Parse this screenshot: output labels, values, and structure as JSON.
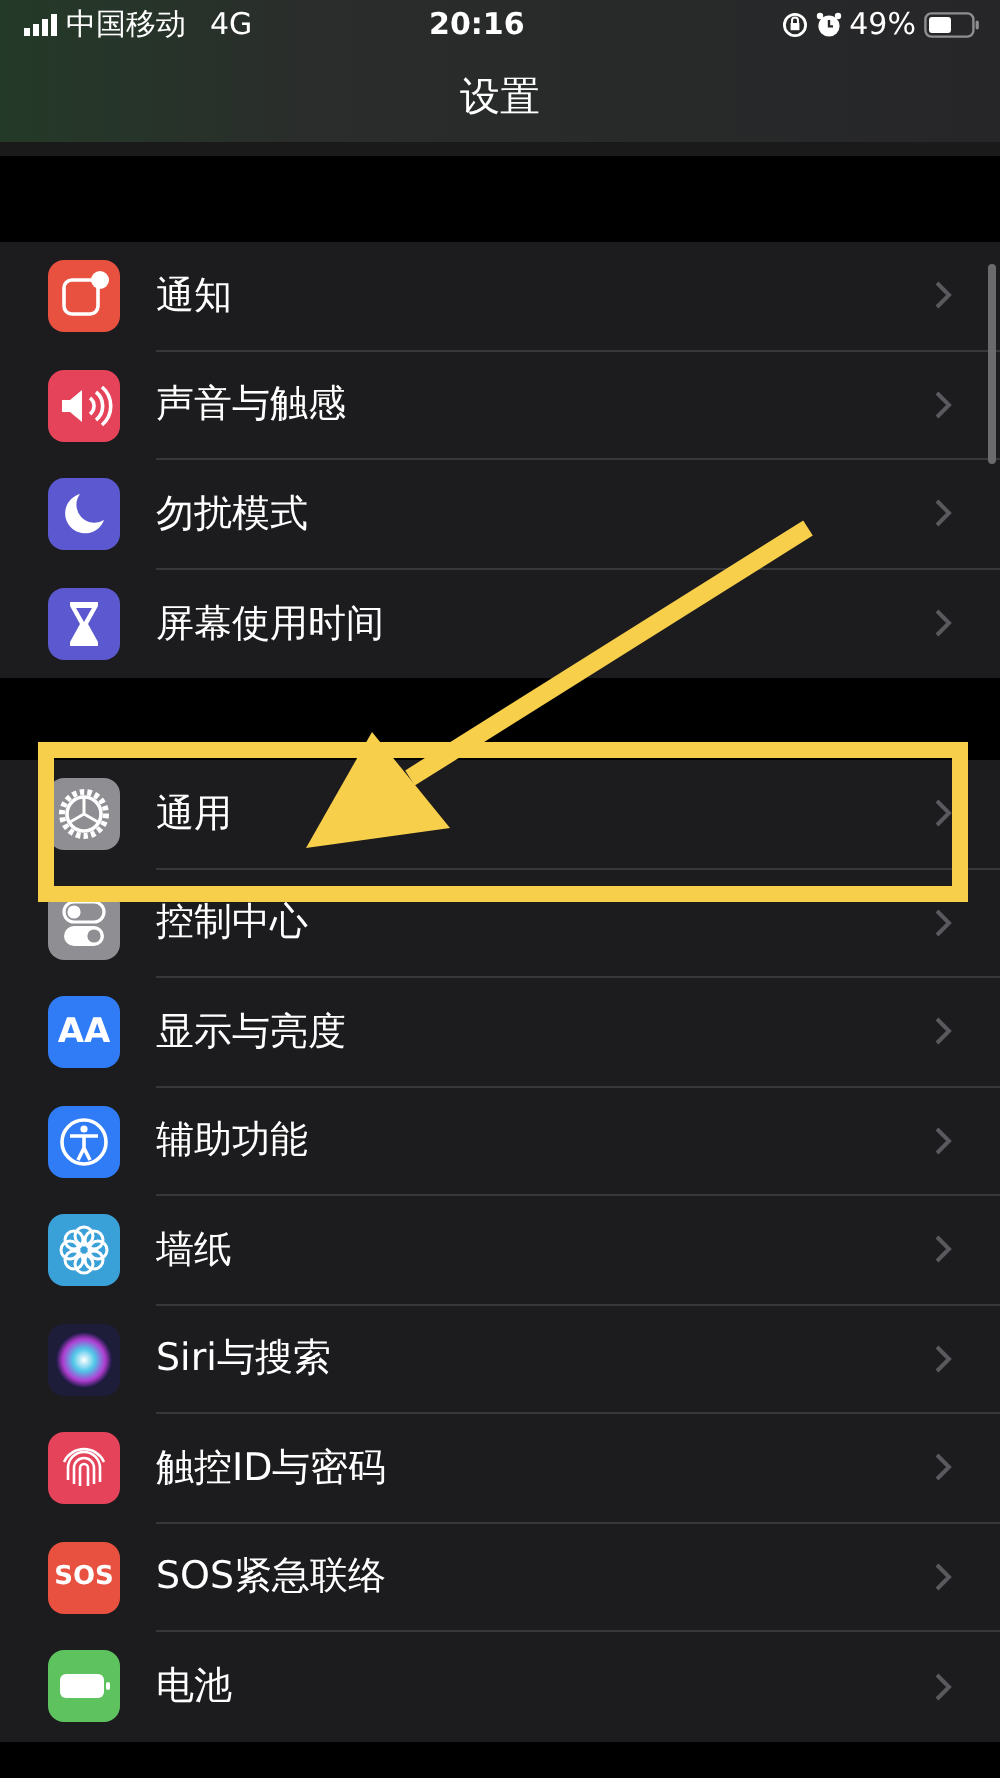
{
  "status_bar": {
    "carrier": "中国移动",
    "network": "4G",
    "time": "20:16",
    "battery": "49%"
  },
  "nav": {
    "title": "设置"
  },
  "groups": [
    {
      "items": [
        {
          "label": "通知",
          "color": "#e8503f"
        },
        {
          "label": "声音与触感",
          "color": "#e5435a"
        },
        {
          "label": "勿扰模式",
          "color": "#5b58d0"
        },
        {
          "label": "屏幕使用时间",
          "color": "#5b58d0"
        }
      ]
    },
    {
      "items": [
        {
          "label": "通用",
          "color": "#8e8e93"
        },
        {
          "label": "控制中心",
          "color": "#8e8e93"
        },
        {
          "label": "显示与亮度",
          "color": "#2f7cf6",
          "icon_text": "AA"
        },
        {
          "label": "辅助功能",
          "color": "#2f7cf6"
        },
        {
          "label": "墙纸",
          "color": "#3aa0d8"
        },
        {
          "label": "Siri与搜索",
          "color": "#1d1d3a"
        },
        {
          "label": "触控ID与密码",
          "color": "#e5435a"
        },
        {
          "label": "SOS紧急联络",
          "color": "#e8503f",
          "icon_text": "SOS"
        },
        {
          "label": "电池",
          "color": "#5ec35f"
        }
      ]
    }
  ]
}
